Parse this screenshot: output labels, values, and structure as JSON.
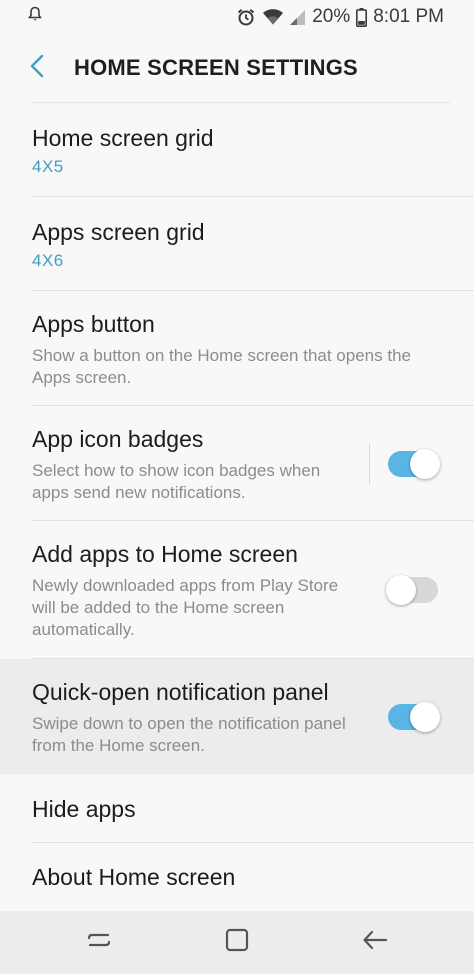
{
  "status_bar": {
    "battery_percent": "20%",
    "time": "8:01 PM"
  },
  "header": {
    "title": "HOME SCREEN SETTINGS"
  },
  "settings": [
    {
      "title": "Home screen grid",
      "value": "4X5"
    },
    {
      "title": "Apps screen grid",
      "value": "4X6"
    },
    {
      "title": "Apps button",
      "subtitle": "Show a button on the Home screen that opens the Apps screen."
    },
    {
      "title": "App icon badges",
      "subtitle": "Select how to show icon badges when apps send new notifications.",
      "toggle": true
    },
    {
      "title": "Add apps to Home screen",
      "subtitle": "Newly downloaded apps from Play Store will be added to the Home screen automatically.",
      "toggle": false
    },
    {
      "title": "Quick-open notification panel",
      "subtitle": "Swipe down to open the notification panel from the Home screen.",
      "toggle": true
    },
    {
      "title": "Hide apps"
    },
    {
      "title": "About Home screen"
    }
  ],
  "colors": {
    "accent": "#3e9fc3",
    "toggle_on": "#5bb5e4",
    "toggle_off": "#d8d8d8",
    "highlight_row": "#ececec"
  },
  "icons": {
    "status_left": "notification-bell-icon",
    "status_right": [
      "alarm-icon",
      "wifi-icon",
      "signal-icon",
      "battery-icon"
    ],
    "header": "back-chevron-icon",
    "nav": [
      "recent-apps-icon",
      "home-icon",
      "back-icon"
    ]
  }
}
